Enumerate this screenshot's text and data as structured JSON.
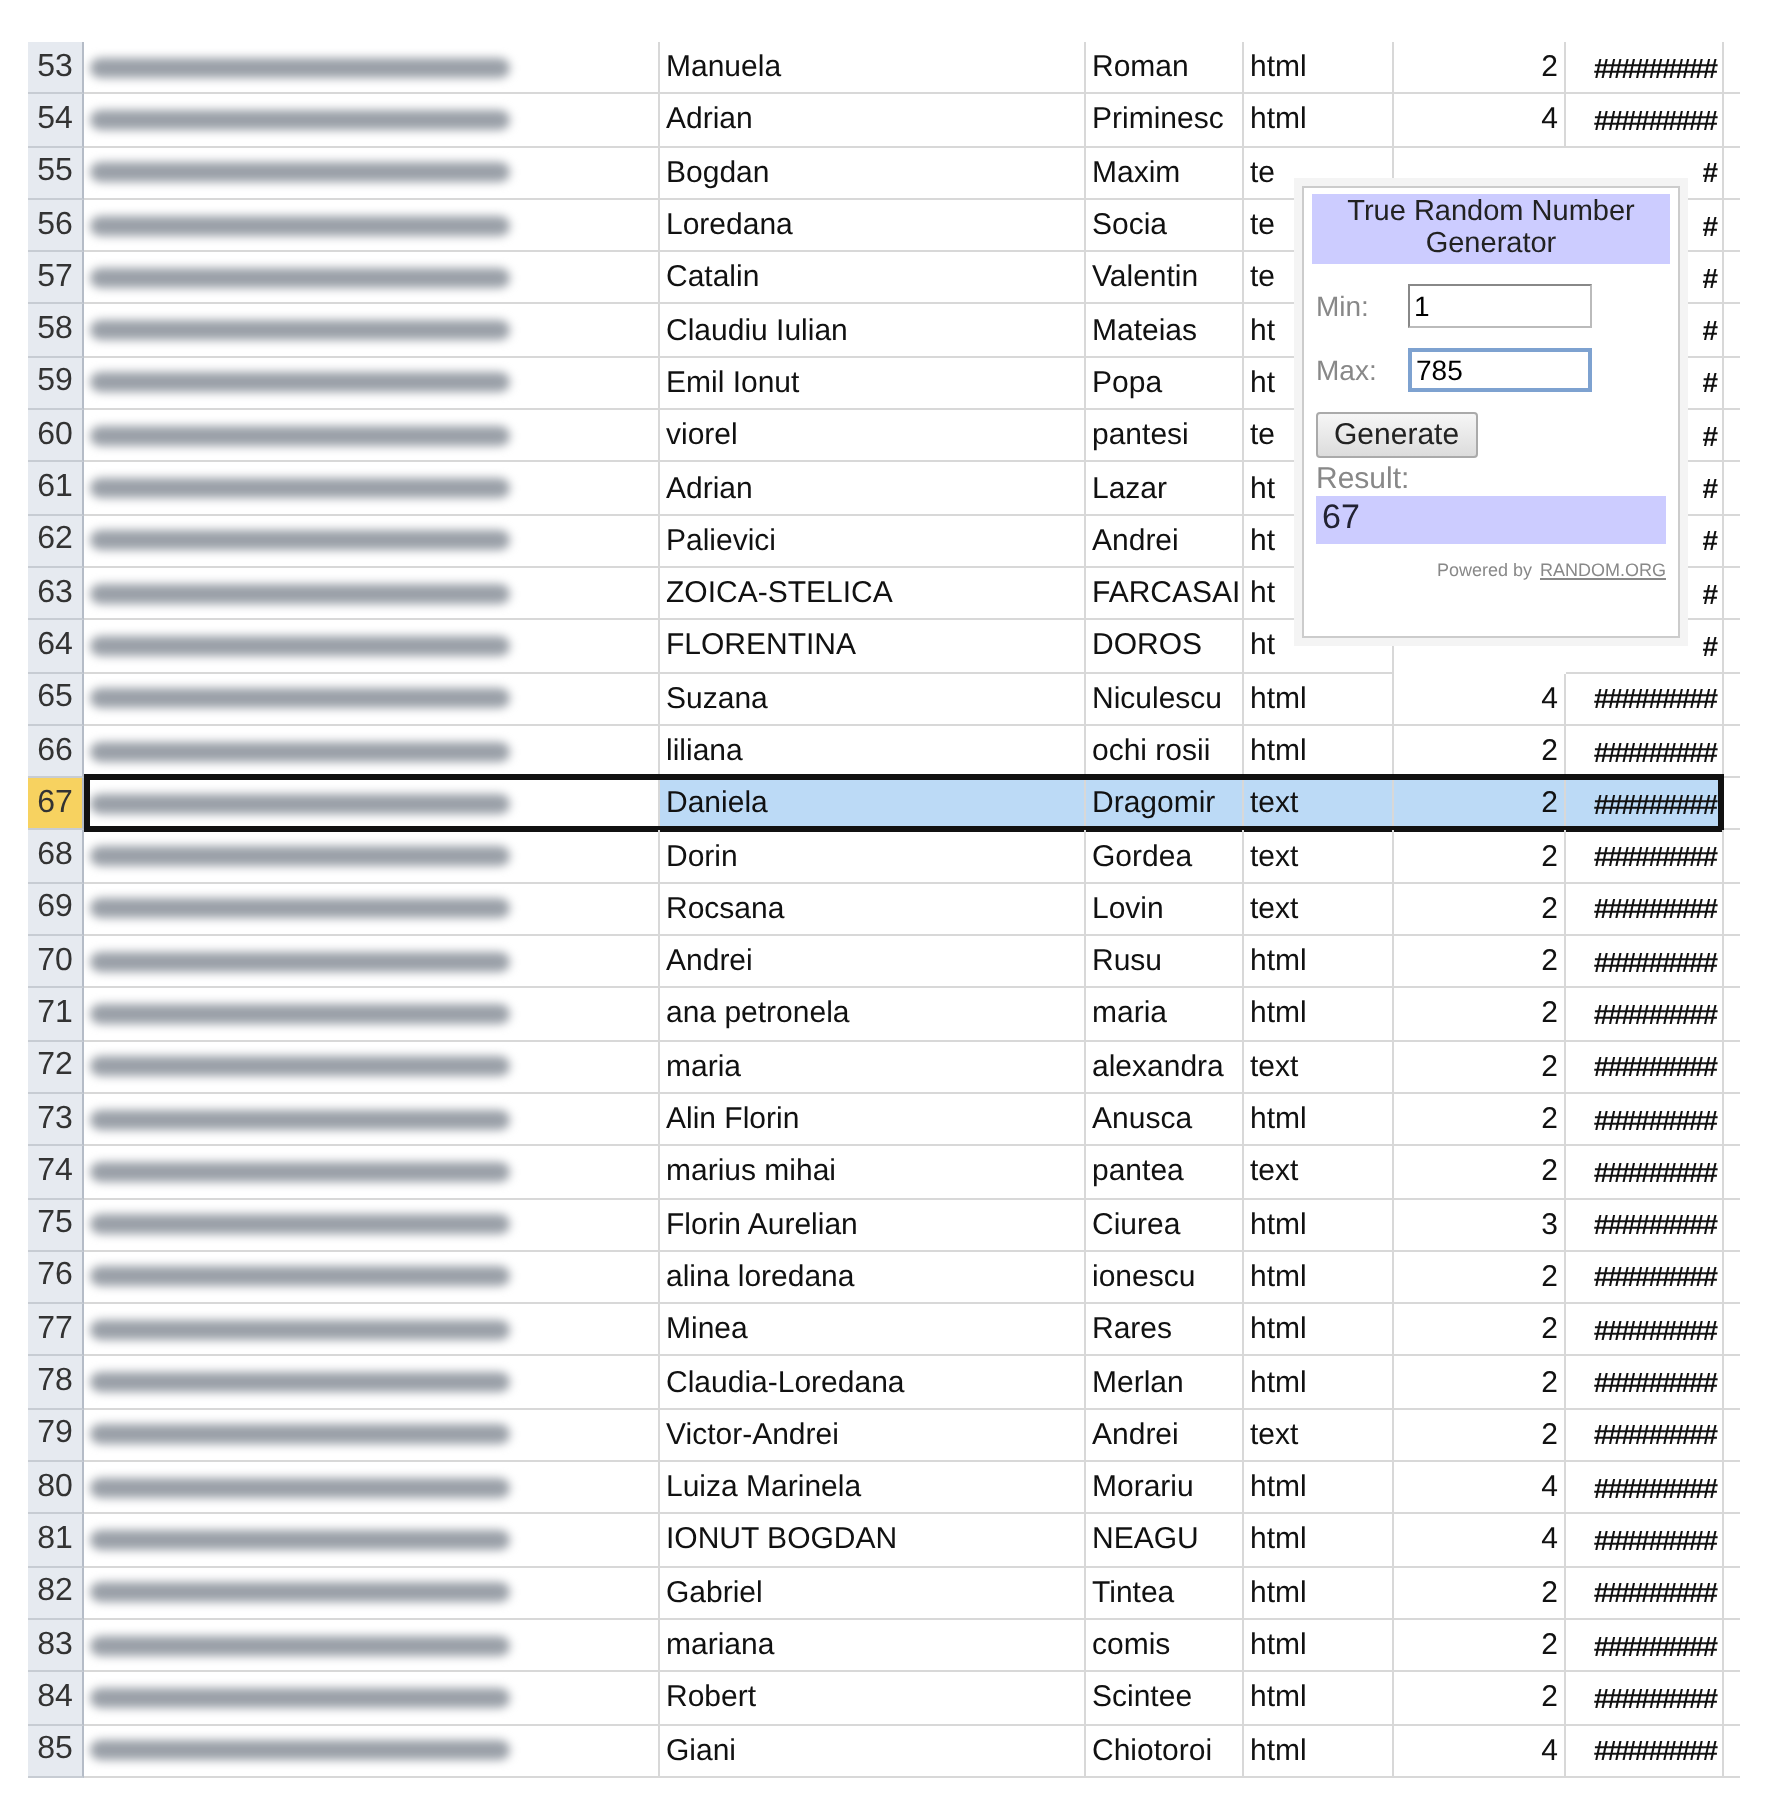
{
  "rows": [
    {
      "number": "53",
      "first_name": "Manuela",
      "last_name": "Roman",
      "type": "html",
      "count": "2",
      "date": "#########",
      "selected": false
    },
    {
      "number": "54",
      "first_name": "Adrian",
      "last_name": "Priminesc",
      "type": "html",
      "count": "4",
      "date": "#########",
      "selected": false
    },
    {
      "number": "55",
      "first_name": "Bogdan",
      "last_name": "Maxim",
      "type": "te",
      "date": "#",
      "selected": false
    },
    {
      "number": "56",
      "first_name": "Loredana",
      "last_name": "Socia",
      "type": "te",
      "date": "#",
      "selected": false
    },
    {
      "number": "57",
      "first_name": "Catalin",
      "last_name": "Valentin",
      "type": "te",
      "date": "#",
      "selected": false
    },
    {
      "number": "58",
      "first_name": "Claudiu Iulian",
      "last_name": "Mateias",
      "type": "ht",
      "date": "#",
      "selected": false
    },
    {
      "number": "59",
      "first_name": "Emil Ionut",
      "last_name": "Popa",
      "type": "ht",
      "date": "#",
      "selected": false
    },
    {
      "number": "60",
      "first_name": "viorel",
      "last_name": "pantesi",
      "type": "te",
      "date": "#",
      "selected": false
    },
    {
      "number": "61",
      "first_name": "Adrian",
      "last_name": "Lazar",
      "type": "ht",
      "date": "#",
      "selected": false
    },
    {
      "number": "62",
      "first_name": "Palievici",
      "last_name": "Andrei",
      "type": "ht",
      "date": "#",
      "selected": false
    },
    {
      "number": "63",
      "first_name": "ZOICA-STELICA",
      "last_name": "FARCASAI",
      "type": "ht",
      "date": "#",
      "selected": false
    },
    {
      "number": "64",
      "first_name": "FLORENTINA",
      "last_name": "DOROS",
      "type": "ht",
      "date": "#",
      "selected": false
    },
    {
      "number": "65",
      "first_name": "Suzana",
      "last_name": "Niculescu",
      "type": "html",
      "count": "4",
      "date": "#########",
      "selected": false
    },
    {
      "number": "66",
      "first_name": "liliana",
      "last_name": "ochi rosii",
      "type": "html",
      "count": "2",
      "date": "#########",
      "selected": false
    },
    {
      "number": "67",
      "first_name": "Daniela",
      "last_name": "Dragomir",
      "type": "text",
      "count": "2",
      "date": "#########",
      "selected": true
    },
    {
      "number": "68",
      "first_name": "Dorin",
      "last_name": "Gordea",
      "type": "text",
      "count": "2",
      "date": "#########",
      "selected": false
    },
    {
      "number": "69",
      "first_name": "Rocsana",
      "last_name": "Lovin",
      "type": "text",
      "count": "2",
      "date": "#########",
      "selected": false
    },
    {
      "number": "70",
      "first_name": "Andrei",
      "last_name": "Rusu",
      "type": "html",
      "count": "2",
      "date": "#########",
      "selected": false
    },
    {
      "number": "71",
      "first_name": "ana petronela",
      "last_name": "maria",
      "type": "html",
      "count": "2",
      "date": "#########",
      "selected": false
    },
    {
      "number": "72",
      "first_name": "maria",
      "last_name": "alexandra",
      "type": "text",
      "count": "2",
      "date": "#########",
      "selected": false
    },
    {
      "number": "73",
      "first_name": "Alin Florin",
      "last_name": "Anusca",
      "type": "html",
      "count": "2",
      "date": "#########",
      "selected": false
    },
    {
      "number": "74",
      "first_name": "marius mihai",
      "last_name": "pantea",
      "type": "text",
      "count": "2",
      "date": "#########",
      "selected": false
    },
    {
      "number": "75",
      "first_name": "Florin Aurelian",
      "last_name": "Ciurea",
      "type": "html",
      "count": "3",
      "date": "#########",
      "selected": false
    },
    {
      "number": "76",
      "first_name": "alina loredana",
      "last_name": "ionescu",
      "type": "html",
      "count": "2",
      "date": "#########",
      "selected": false
    },
    {
      "number": "77",
      "first_name": "Minea",
      "last_name": "Rares",
      "type": "html",
      "count": "2",
      "date": "#########",
      "selected": false
    },
    {
      "number": "78",
      "first_name": "Claudia-Loredana",
      "last_name": "Merlan",
      "type": "html",
      "count": "2",
      "date": "#########",
      "selected": false
    },
    {
      "number": "79",
      "first_name": "Victor-Andrei",
      "last_name": "Andrei",
      "type": "text",
      "count": "2",
      "date": "#########",
      "selected": false
    },
    {
      "number": "80",
      "first_name": "Luiza Marinela",
      "last_name": "Morariu",
      "type": "html",
      "count": "4",
      "date": "#########",
      "selected": false
    },
    {
      "number": "81",
      "first_name": "IONUT BOGDAN",
      "last_name": "NEAGU",
      "type": "html",
      "count": "4",
      "date": "#########",
      "selected": false
    },
    {
      "number": "82",
      "first_name": "Gabriel",
      "last_name": "Tintea",
      "type": "html",
      "count": "2",
      "date": "#########",
      "selected": false
    },
    {
      "number": "83",
      "first_name": "mariana",
      "last_name": "comis",
      "type": "html",
      "count": "2",
      "date": "#########",
      "selected": false
    },
    {
      "number": "84",
      "first_name": "Robert",
      "last_name": "Scintee",
      "type": "html",
      "count": "2",
      "date": "#########",
      "selected": false
    },
    {
      "number": "85",
      "first_name": "Giani",
      "last_name": "Chiotoroi",
      "type": "html",
      "count": "4",
      "date": "#########",
      "selected": false
    }
  ],
  "widget": {
    "title": "True Random Number Generator",
    "min_label": "Min:",
    "min_value": "1",
    "max_label": "Max:",
    "max_value": "785",
    "button": "Generate",
    "result_label": "Result:",
    "result": "67",
    "powered_by": "Powered by",
    "link": "RANDOM.ORG"
  }
}
